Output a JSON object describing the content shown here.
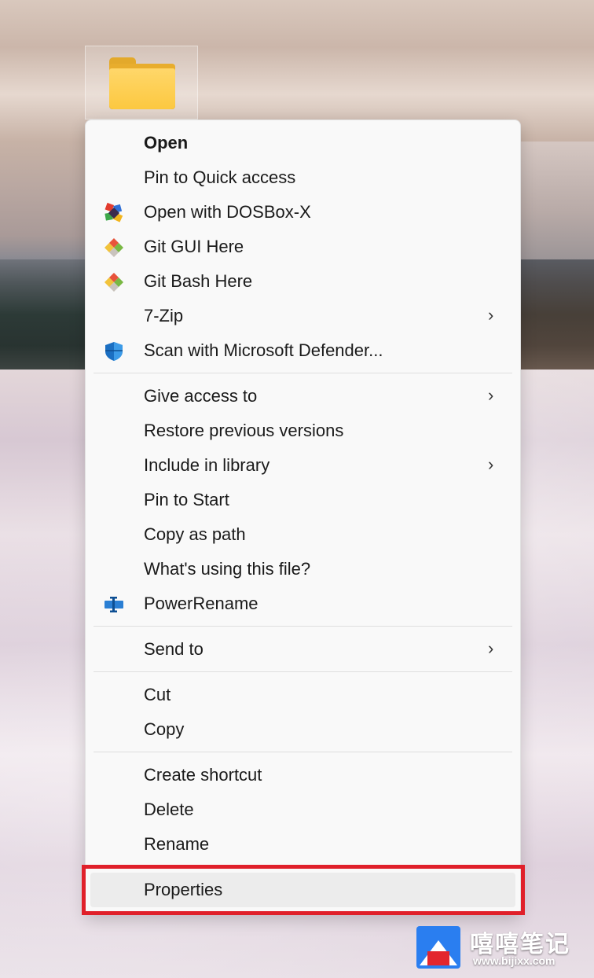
{
  "desktop": {
    "icon_name": "folder-icon"
  },
  "menu": {
    "groups": [
      [
        {
          "label": "Open",
          "bold": true
        },
        {
          "label": "Pin to Quick access"
        },
        {
          "label": "Open with DOSBox-X",
          "icon": "dosbox-icon"
        },
        {
          "label": "Git GUI Here",
          "icon": "git-icon"
        },
        {
          "label": "Git Bash Here",
          "icon": "git-icon"
        },
        {
          "label": "7-Zip",
          "submenu": true
        },
        {
          "label": "Scan with Microsoft Defender...",
          "icon": "defender-shield-icon"
        }
      ],
      [
        {
          "label": "Give access to",
          "submenu": true
        },
        {
          "label": "Restore previous versions"
        },
        {
          "label": "Include in library",
          "submenu": true
        },
        {
          "label": "Pin to Start"
        },
        {
          "label": "Copy as path"
        },
        {
          "label": "What's using this file?"
        },
        {
          "label": "PowerRename",
          "icon": "powerrename-icon"
        }
      ],
      [
        {
          "label": "Send to",
          "submenu": true
        }
      ],
      [
        {
          "label": "Cut"
        },
        {
          "label": "Copy"
        }
      ],
      [
        {
          "label": "Create shortcut"
        },
        {
          "label": "Delete"
        },
        {
          "label": "Rename"
        }
      ],
      [
        {
          "label": "Properties",
          "highlighted": true
        }
      ]
    ],
    "submenu_glyph": "›"
  },
  "watermark": {
    "name": "嘻嘻笔记",
    "url": "www.bijixx.com"
  },
  "colors": {
    "highlight_border": "#e0202a",
    "menu_bg": "#f9f9f9"
  }
}
